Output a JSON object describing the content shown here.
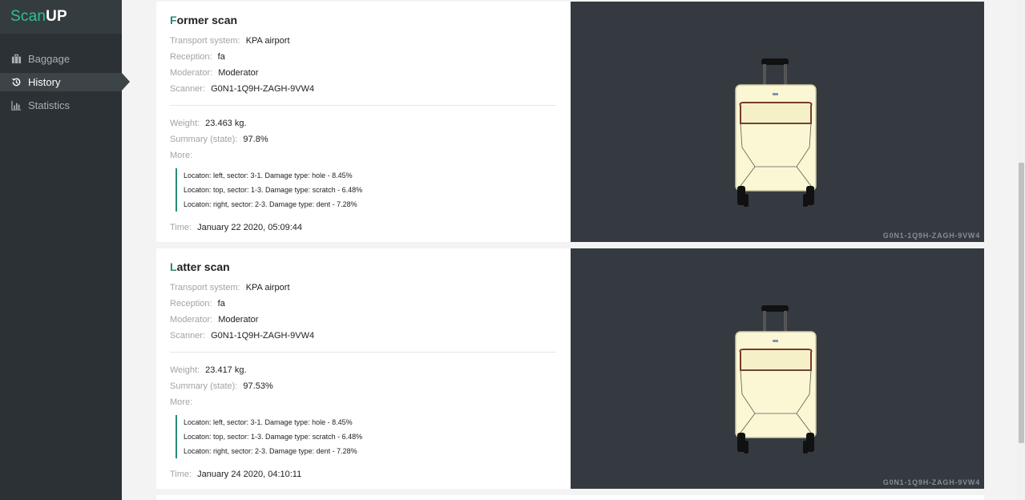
{
  "app": {
    "logo_scan": "Scan",
    "logo_up": "UP"
  },
  "sidebar": {
    "items": [
      {
        "label": "Baggage",
        "icon": "briefcase-icon",
        "active": false
      },
      {
        "label": "History",
        "icon": "history-icon",
        "active": true
      },
      {
        "label": "Statistics",
        "icon": "bar-chart-icon",
        "active": false
      }
    ]
  },
  "labels": {
    "transport": "Transport system:",
    "reception": "Reception:",
    "moderator": "Moderator:",
    "scanner": "Scanner:",
    "weight": "Weight:",
    "summary": "Summary (state):",
    "more": "More:",
    "time": "Time:"
  },
  "scans": [
    {
      "title_initial": "F",
      "title_rest": "ormer scan",
      "transport": "KPA airport",
      "reception": "fa",
      "moderator": "Moderator",
      "scanner": "G0N1-1Q9H-ZAGH-9VW4",
      "weight": "23.463 kg.",
      "summary": "97.8%",
      "damages": [
        "Locaton: left, sector: 3-1. Damage type: hole - 8.45%",
        "Locaton: top, sector: 1-3. Damage type: scratch - 6.48%",
        "Locaton: right, sector: 2-3. Damage type: dent - 7.28%"
      ],
      "time": "January 22 2020, 05:09:44",
      "photo_caption": "G0N1-1Q9H-ZAGH-9VW4"
    },
    {
      "title_initial": "L",
      "title_rest": "atter scan",
      "transport": "KPA airport",
      "reception": "fa",
      "moderator": "Moderator",
      "scanner": "G0N1-1Q9H-ZAGH-9VW4",
      "weight": "23.417 kg.",
      "summary": "97.53%",
      "damages": [
        "Locaton: left, sector: 3-1. Damage type: hole - 8.45%",
        "Locaton: top, sector: 1-3. Damage type: scratch - 6.48%",
        "Locaton: right, sector: 2-3. Damage type: dent - 7.28%"
      ],
      "time": "January 24 2020, 04:10:11",
      "photo_caption": "G0N1-1Q9H-ZAGH-9VW4"
    }
  ],
  "colors": {
    "accent": "#2b8a79",
    "logo_green": "#2fbf95",
    "sidebar_bg": "#2b3134",
    "photo_bg": "#343a40"
  }
}
